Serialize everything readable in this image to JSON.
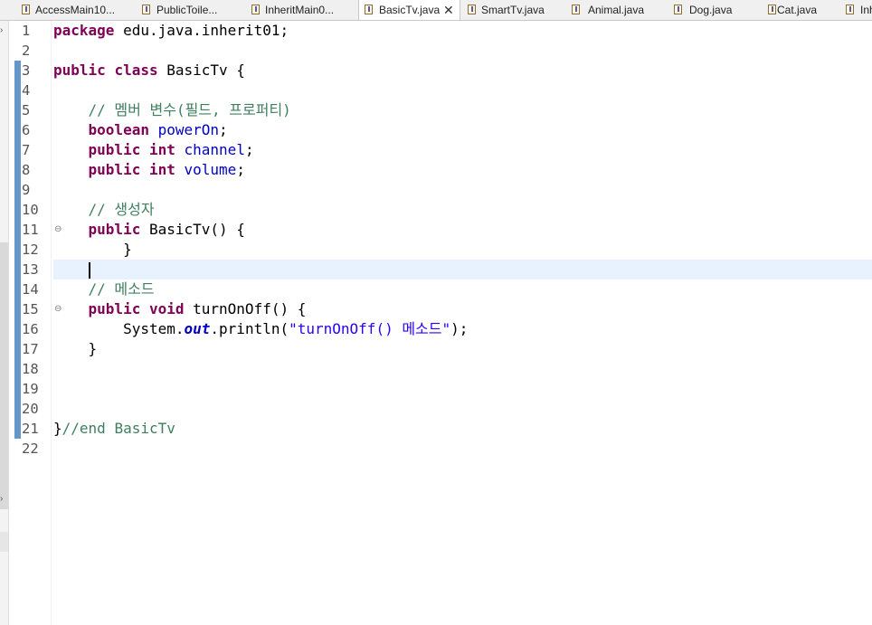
{
  "tabs": [
    {
      "label": "AccessMain10..."
    },
    {
      "label": "PublicToile..."
    },
    {
      "label": "InheritMain0..."
    },
    {
      "label": "BasicTv.java",
      "active": true
    },
    {
      "label": "SmartTv.java"
    },
    {
      "label": "Animal.java"
    },
    {
      "label": "Dog.java"
    },
    {
      "label": "Cat.java"
    },
    {
      "label": "Inh"
    }
  ],
  "editor": {
    "file": "BasicTv.java",
    "current_line": 13,
    "lines": [
      {
        "n": "1",
        "tokens": [
          [
            "kw",
            "package"
          ],
          [
            "t",
            " edu.java.inherit01;"
          ]
        ]
      },
      {
        "n": "2",
        "tokens": []
      },
      {
        "n": "3",
        "tokens": [
          [
            "kw",
            "public"
          ],
          [
            "t",
            " "
          ],
          [
            "kw",
            "class"
          ],
          [
            "t",
            " BasicTv {"
          ]
        ]
      },
      {
        "n": "4",
        "tokens": []
      },
      {
        "n": "5",
        "tokens": [
          [
            "t",
            "    "
          ],
          [
            "cm",
            "// 멤버 변수(필드, 프로퍼티)"
          ]
        ]
      },
      {
        "n": "6",
        "tokens": [
          [
            "t",
            "    "
          ],
          [
            "kw",
            "boolean"
          ],
          [
            "t",
            " "
          ],
          [
            "fld",
            "powerOn"
          ],
          [
            "t",
            ";"
          ]
        ]
      },
      {
        "n": "7",
        "tokens": [
          [
            "t",
            "    "
          ],
          [
            "kw",
            "public"
          ],
          [
            "t",
            " "
          ],
          [
            "kw",
            "int"
          ],
          [
            "t",
            " "
          ],
          [
            "fld",
            "channel"
          ],
          [
            "t",
            ";"
          ]
        ]
      },
      {
        "n": "8",
        "tokens": [
          [
            "t",
            "    "
          ],
          [
            "kw",
            "public"
          ],
          [
            "t",
            " "
          ],
          [
            "kw",
            "int"
          ],
          [
            "t",
            " "
          ],
          [
            "fld",
            "volume"
          ],
          [
            "t",
            ";"
          ]
        ]
      },
      {
        "n": "9",
        "tokens": []
      },
      {
        "n": "10",
        "tokens": [
          [
            "t",
            "    "
          ],
          [
            "cm",
            "// 생성자"
          ]
        ]
      },
      {
        "n": "11",
        "fold": true,
        "tokens": [
          [
            "t",
            "    "
          ],
          [
            "kw",
            "public"
          ],
          [
            "t",
            " BasicTv() {"
          ]
        ]
      },
      {
        "n": "12",
        "tokens": [
          [
            "t",
            "        }"
          ]
        ]
      },
      {
        "n": "13",
        "tokens": [
          [
            "t",
            "    "
          ]
        ],
        "caret": true
      },
      {
        "n": "14",
        "tokens": [
          [
            "t",
            "    "
          ],
          [
            "cm",
            "// 메소드"
          ]
        ]
      },
      {
        "n": "15",
        "fold": true,
        "tokens": [
          [
            "t",
            "    "
          ],
          [
            "kw",
            "public"
          ],
          [
            "t",
            " "
          ],
          [
            "kw",
            "void"
          ],
          [
            "t",
            " turnOnOff() {"
          ]
        ]
      },
      {
        "n": "16",
        "tokens": [
          [
            "t",
            "        System."
          ],
          [
            "st",
            "out"
          ],
          [
            "t",
            ".println("
          ],
          [
            "str",
            "\"turnOnOff() 메소드\""
          ],
          [
            "t",
            ");"
          ]
        ]
      },
      {
        "n": "17",
        "tokens": [
          [
            "t",
            "    }"
          ]
        ]
      },
      {
        "n": "18",
        "tokens": []
      },
      {
        "n": "19",
        "tokens": []
      },
      {
        "n": "20",
        "tokens": []
      },
      {
        "n": "21",
        "tokens": [
          [
            "t",
            "}"
          ],
          [
            "cm",
            "//end BasicTv"
          ]
        ]
      },
      {
        "n": "22",
        "tokens": []
      }
    ]
  },
  "colors": {
    "keyword": "#7f0055",
    "comment": "#3f7f5f",
    "field": "#0000c0",
    "string": "#2a00ff",
    "current_line": "#e8f2fe",
    "change_marker": "#4a84c0"
  },
  "icons": {
    "tab_file": "java-file-icon",
    "close": "close-icon",
    "fold": "fold-collapse-icon"
  }
}
